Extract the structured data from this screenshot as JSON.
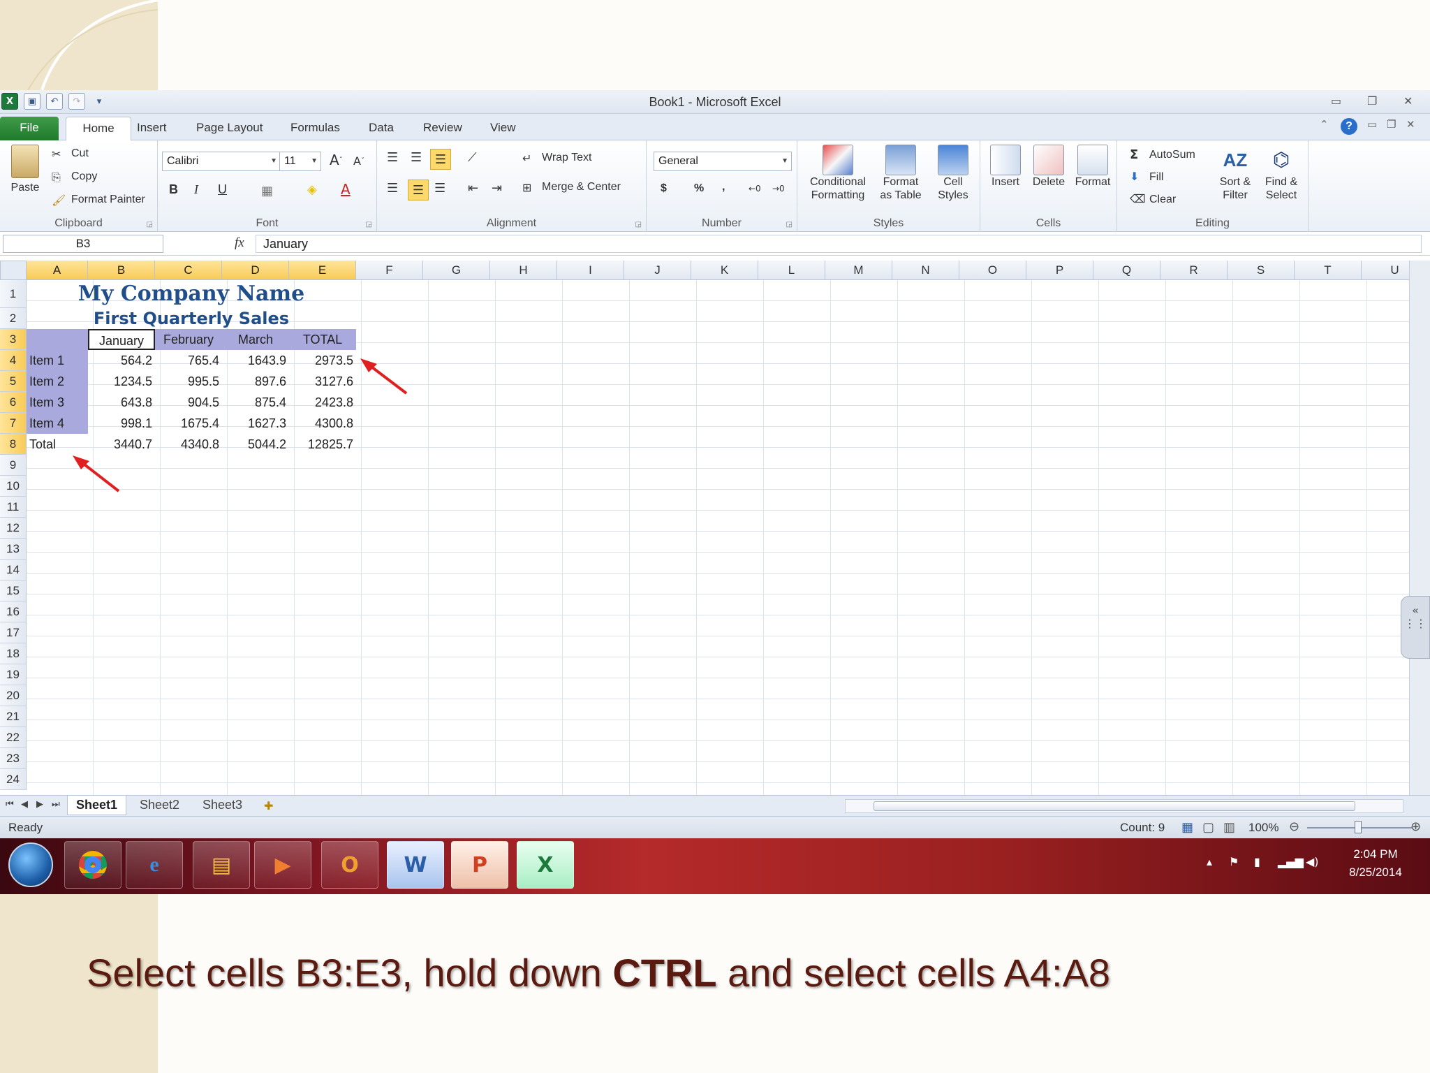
{
  "window": {
    "title": "Book1 - Microsoft Excel"
  },
  "tabs": [
    "File",
    "Home",
    "Insert",
    "Page Layout",
    "Formulas",
    "Data",
    "Review",
    "View"
  ],
  "clipboard": {
    "paste": "Paste",
    "cut": "Cut",
    "copy": "Copy",
    "format_painter": "Format Painter",
    "label": "Clipboard"
  },
  "font": {
    "name": "Calibri",
    "size": "11",
    "label": "Font",
    "bold": "B",
    "italic": "I",
    "underline": "U"
  },
  "alignment": {
    "wrap": "Wrap Text",
    "merge": "Merge & Center",
    "label": "Alignment"
  },
  "number": {
    "format": "General",
    "currency": "$",
    "percent": "%",
    "comma": ",",
    "label": "Number"
  },
  "styles": {
    "conditional": "Conditional",
    "conditional2": "Formatting",
    "format_table": "Format",
    "format_table2": "as Table",
    "cell_styles": "Cell",
    "cell_styles2": "Styles",
    "label": "Styles"
  },
  "cells": {
    "insert": "Insert",
    "delete": "Delete",
    "format": "Format",
    "label": "Cells"
  },
  "editing": {
    "autosum": "AutoSum",
    "fill": "Fill",
    "clear": "Clear",
    "sort": "Sort &",
    "sort2": "Filter",
    "find": "Find &",
    "find2": "Select",
    "label": "Editing"
  },
  "formula_bar": {
    "name_box": "B3",
    "content": "January"
  },
  "columns": [
    "A",
    "B",
    "C",
    "D",
    "E",
    "F",
    "G",
    "H",
    "I",
    "J",
    "K",
    "L",
    "M",
    "N",
    "O",
    "P",
    "Q",
    "R",
    "S",
    "T",
    "U"
  ],
  "rows": [
    "1",
    "2",
    "3",
    "4",
    "5",
    "6",
    "7",
    "8",
    "9",
    "10",
    "11",
    "12",
    "13",
    "14",
    "15",
    "16",
    "17",
    "18",
    "19",
    "20",
    "21",
    "22",
    "23",
    "24"
  ],
  "sheet": {
    "title": "My Company Name",
    "subtitle": "First Quarterly Sales",
    "headers": [
      "January",
      "February",
      "March",
      "TOTAL"
    ],
    "items": [
      "Item 1",
      "Item 2",
      "Item 3",
      "Item 4",
      "Total"
    ],
    "values": [
      [
        "564.2",
        "765.4",
        "1643.9",
        "2973.5"
      ],
      [
        "1234.5",
        "995.5",
        "897.6",
        "3127.6"
      ],
      [
        "643.8",
        "904.5",
        "875.4",
        "2423.8"
      ],
      [
        "998.1",
        "1675.4",
        "1627.3",
        "4300.8"
      ],
      [
        "3440.7",
        "4340.8",
        "5044.2",
        "12825.7"
      ]
    ]
  },
  "sheet_tabs": [
    "Sheet1",
    "Sheet2",
    "Sheet3"
  ],
  "status": {
    "ready": "Ready",
    "count": "Count: 9",
    "zoom": "100%"
  },
  "taskbar": {
    "time": "2:04 PM",
    "date": "8/25/2014"
  },
  "caption": {
    "part1": "Select cells B3:E3, hold down ",
    "bold": "CTRL",
    "part2": " and select cells A4:A8"
  },
  "colors": {
    "selected_header": "#f8cb57",
    "table_fill": "#a9a9dd",
    "title_blue": "#1f4e8a",
    "arrow": "#e02020"
  }
}
